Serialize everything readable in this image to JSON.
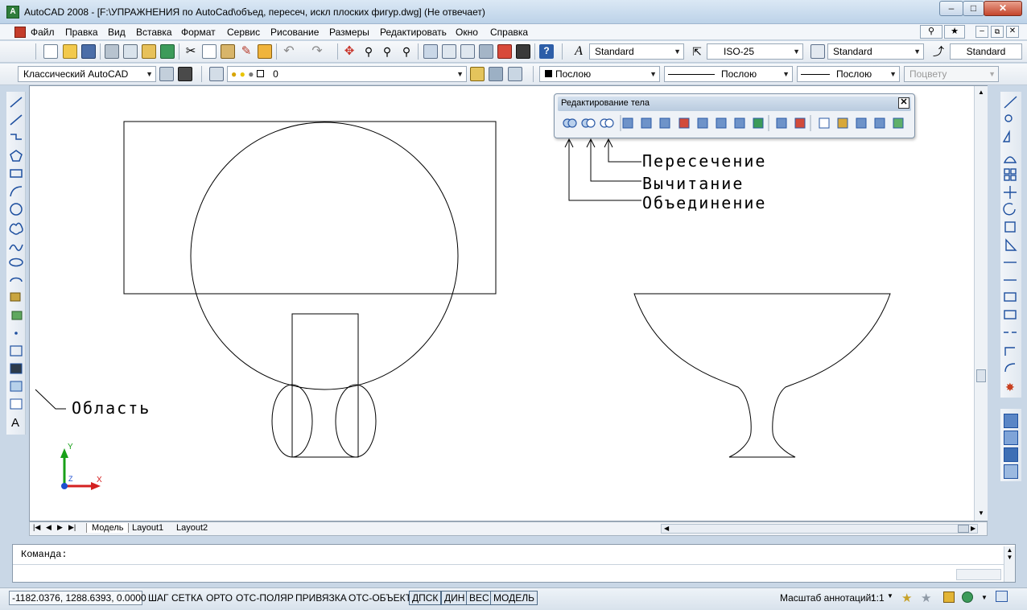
{
  "window": {
    "title": "AutoCAD 2008 - [F:\\УПРАЖНЕНИЯ по AutoCad\\объед, пересеч, искл плоских фигур.dwg] (Не отвечает)",
    "app_icon_letter": "A"
  },
  "menu": {
    "items": [
      "Файл",
      "Правка",
      "Вид",
      "Вставка",
      "Формат",
      "Сервис",
      "Рисование",
      "Размеры",
      "Редактировать",
      "Окно",
      "Справка"
    ]
  },
  "toolbar_styles": {
    "text_style": "Standard",
    "dim_style": "ISO-25",
    "table_style": "Standard",
    "multileader_style": "Standard"
  },
  "toolbar_layers": {
    "workspace": "Классический AutoCAD",
    "layer": "0",
    "color": "Послою",
    "linetype": "Послою",
    "lineweight": "Послою",
    "plotstyle": "Поцвету"
  },
  "solid_palette": {
    "title": "Редактирование тела",
    "close_glyph": "✕"
  },
  "annotations": {
    "intersection": "Пересечение",
    "subtraction": "Вычитание",
    "union": "Объединение",
    "region": "Область"
  },
  "ucs": {
    "y_label": "Y",
    "x_label": "X",
    "z_label": "Z"
  },
  "tabs": {
    "model": "Модель",
    "layout1": "Layout1",
    "layout2": "Layout2"
  },
  "command": {
    "prompt": "Команда:"
  },
  "status": {
    "coordinates": "-1182.0376, 1288.6393, 0.0000",
    "buttons": [
      "ШАГ",
      "СЕТКА",
      "ОРТО",
      "ОТС-ПОЛЯР",
      "ПРИВЯЗКА",
      "ОТС-ОБЪЕКТ",
      "ДПСК",
      "ДИН",
      "ВЕС",
      "МОДЕЛЬ"
    ],
    "active_buttons": [
      "ДПСК",
      "ДИН",
      "ВЕС",
      "МОДЕЛЬ"
    ],
    "annotation_scale_label": "Масштаб аннотаций:",
    "annotation_scale_value": "1:1"
  },
  "colors": {
    "accent": "#2f7d3b",
    "ucs_x": "#d42020",
    "ucs_y": "#18a018",
    "ucs_origin": "#1e4fd0"
  }
}
